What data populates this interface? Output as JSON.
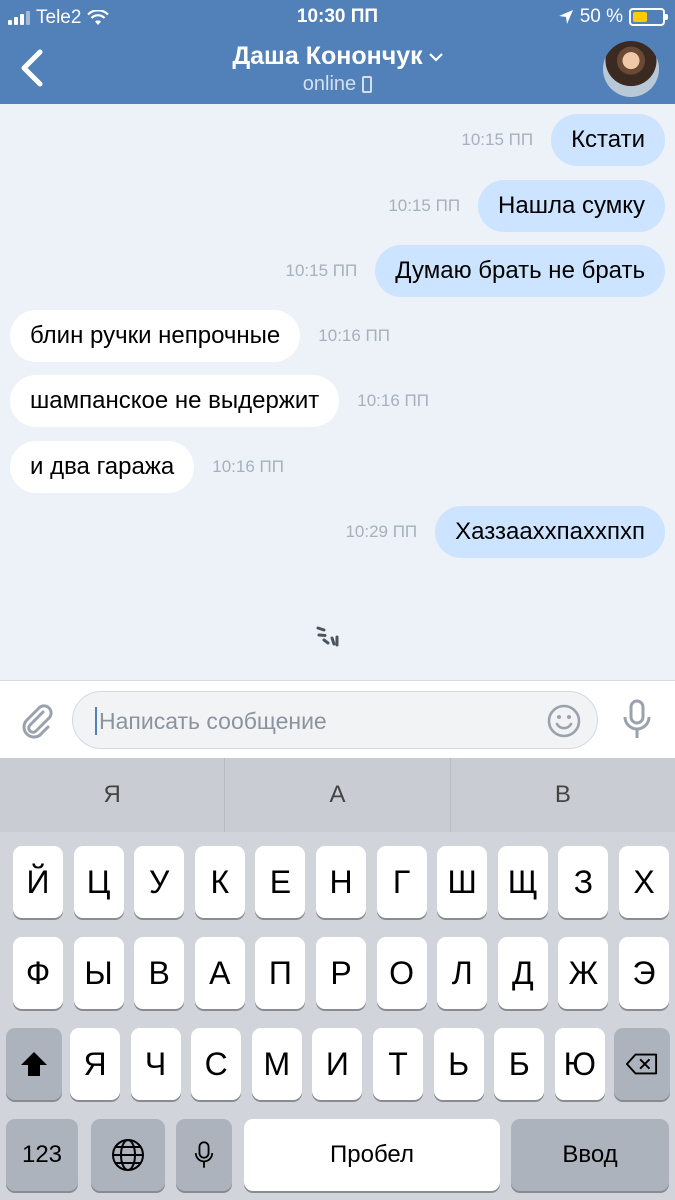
{
  "status_bar": {
    "carrier": "Tele2",
    "time": "10:30 ПП",
    "battery_text": "50 %",
    "battery_level": 0.5,
    "battery_color": "#ffcc00"
  },
  "nav": {
    "contact_name": "Даша Конончук",
    "presence": "online",
    "back_icon": "chevron-left-icon",
    "accent_color": "#5181b8"
  },
  "messages": [
    {
      "direction": "out",
      "text": "Кстати",
      "time": "10:15 ПП"
    },
    {
      "direction": "out",
      "text": "Нашла сумку",
      "time": "10:15 ПП"
    },
    {
      "direction": "out",
      "text": "Думаю брать не брать",
      "time": "10:15 ПП"
    },
    {
      "direction": "in",
      "text": "блин ручки непрочные",
      "time": "10:16 ПП"
    },
    {
      "direction": "in",
      "text": "шампанское не выдержит",
      "time": "10:16 ПП"
    },
    {
      "direction": "in",
      "text": "и два гаража",
      "time": "10:16 ПП"
    },
    {
      "direction": "out",
      "text": "Хаззааххпаххпхп",
      "time": "10:29 ПП"
    }
  ],
  "composer": {
    "placeholder": "Написать сообщение"
  },
  "keyboard": {
    "suggestions": [
      "Я",
      "А",
      "В"
    ],
    "rows": [
      [
        "Й",
        "Ц",
        "У",
        "К",
        "Е",
        "Н",
        "Г",
        "Ш",
        "Щ",
        "З",
        "Х"
      ],
      [
        "Ф",
        "Ы",
        "В",
        "А",
        "П",
        "Р",
        "О",
        "Л",
        "Д",
        "Ж",
        "Э"
      ],
      [
        "Я",
        "Ч",
        "С",
        "М",
        "И",
        "Т",
        "Ь",
        "Б",
        "Ю"
      ]
    ],
    "numbers_label": "123",
    "space_label": "Пробел",
    "return_label": "Ввод"
  }
}
